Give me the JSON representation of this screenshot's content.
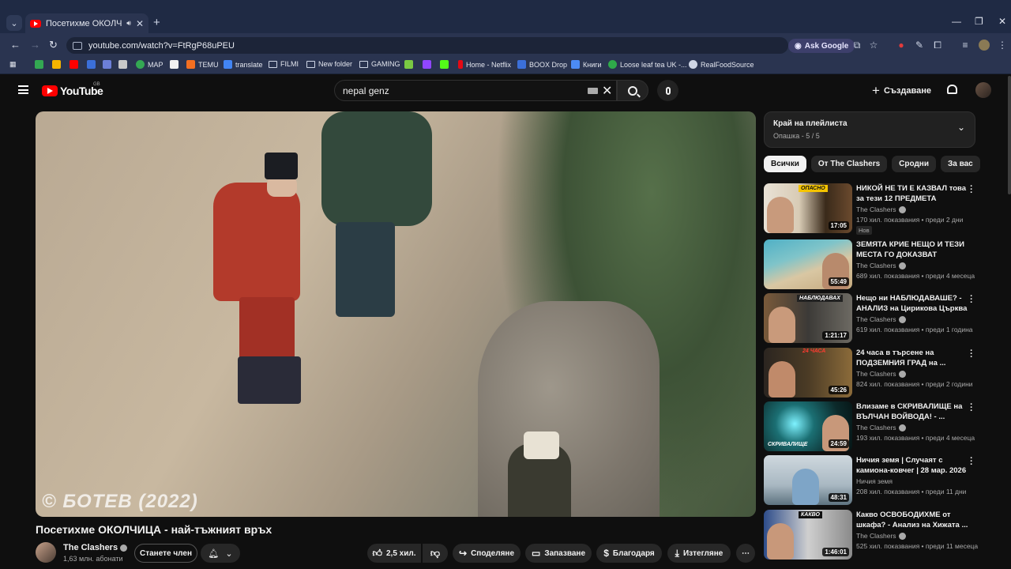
{
  "browser": {
    "tab_title": "Посетихме ОКОЛЧИЦА - н",
    "url": "youtube.com/watch?v=FtRgP68uPEU",
    "ask_google": "Ask Google",
    "bookmarks": [
      "MAP",
      "TEMU",
      "translate",
      "FILMI",
      "New folder",
      "GAMING",
      "Home - Netflix",
      "BOOX Drop",
      "Книги",
      "Loose leaf tea UK -...",
      "RealFoodSource"
    ]
  },
  "header": {
    "logo_text": "YouTube",
    "region": "GB",
    "search_value": "nepal genz",
    "create_label": "Създаване"
  },
  "video": {
    "watermark": "© БОТЕВ (2022)",
    "title": "Посетихме ОКОЛЧИЦА - най-тъжният връх",
    "channel": "The Clashers",
    "subscribers": "1,63 млн. абонати",
    "join_label": "Станете член",
    "likes": "2,5 хил.",
    "share_label": "Споделяне",
    "save_label": "Запазване",
    "thanks_label": "Благодаря",
    "download_label": "Изтегляне"
  },
  "playlist": {
    "title": "Край на плейлиста",
    "subtitle": "Опашка - 5 / 5"
  },
  "chips": [
    "Всички",
    "От The Clashers",
    "Сродни",
    "За вас"
  ],
  "recommendations": [
    {
      "title": "НИКОЙ НЕ ТИ Е КАЗВАЛ това за тези 12 ПРЕДМЕТА",
      "channel": "The Clashers",
      "meta": "170 хил. показвания • преди 2 дни",
      "badge": "Нов",
      "duration": "17:05",
      "tag": "ОПАСНО"
    },
    {
      "title": "ЗЕМЯТА КРИЕ НЕЩО И ТЕЗИ МЕСТА ГО ДОКАЗВАТ",
      "channel": "The Clashers",
      "meta": "689 хил. показвания • преди 4 месеца",
      "duration": "55:49",
      "tag": ""
    },
    {
      "title": "Нещо ни НАБЛЮДАВАШЕ? - АНАЛИЗ на Цирикова Църква",
      "channel": "The Clashers",
      "meta": "619 хил. показвания • преди 1 година",
      "duration": "1:21:17",
      "tag": "НАБЛЮДАВАХ"
    },
    {
      "title": "24 часа в търсене на ПОДЗЕМНИЯ ГРАД на ...",
      "channel": "The Clashers",
      "meta": "824 хил. показвания • преди 2 години",
      "duration": "45:26",
      "tag": "24 ЧАСА"
    },
    {
      "title": "Влизаме в СКРИВАЛИЩЕ на ВЪЛЧАН ВОЙВОДА! - ...",
      "channel": "The Clashers",
      "meta": "193 хил. показвания • преди 4 месеца",
      "duration": "24:59",
      "tag": "СКРИВАЛИЩЕ"
    },
    {
      "title": "Ничия земя | Случаят с камиона-ковчег | 28 мар. 2026",
      "channel": "Ничия земя",
      "meta": "208 хил. показвания • преди 11 дни",
      "duration": "48:31",
      "tag": ""
    },
    {
      "title": "Какво ОСВОБОДИХМЕ от шкафа? - Анализ на Хижата ...",
      "channel": "The Clashers",
      "meta": "525 хил. показвания • преди 11 месеца",
      "duration": "1:46:01",
      "tag": "КАКВО"
    }
  ],
  "colors": {
    "accent": "#ff0000",
    "background": "#0f0f0f",
    "chrome": "#2a3450"
  }
}
